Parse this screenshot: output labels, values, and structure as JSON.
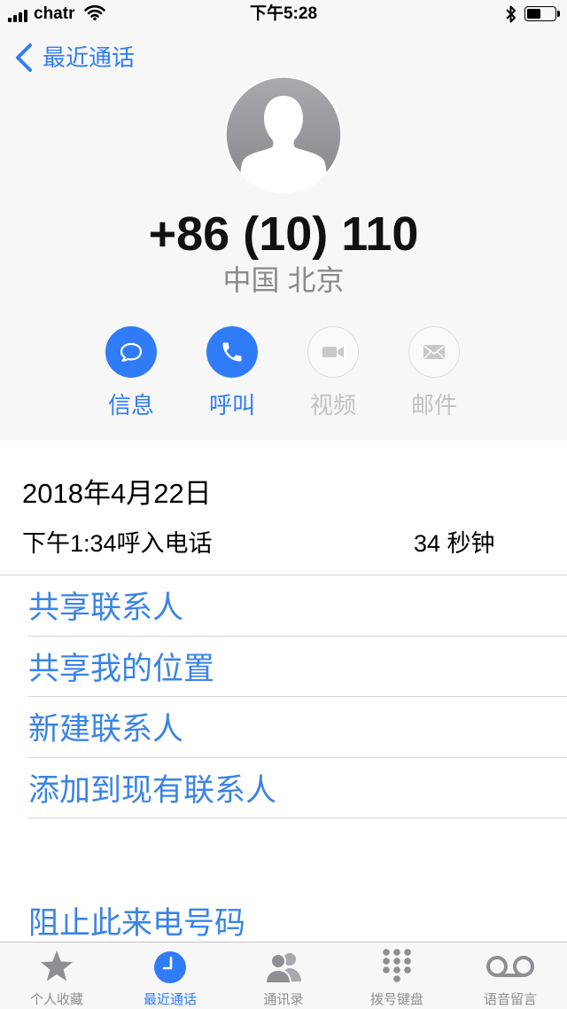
{
  "status_bar": {
    "carrier": "chatr",
    "time": "下午5:28",
    "battery_level": 0.5
  },
  "nav": {
    "back_label": "最近通话"
  },
  "contact": {
    "number": "+86 (10) 110",
    "location": "中国 北京",
    "avatar_icon": "person-silhouette-icon"
  },
  "actions": [
    {
      "label": "信息",
      "icon": "message-icon",
      "enabled": true
    },
    {
      "label": "呼叫",
      "icon": "phone-icon",
      "enabled": true
    },
    {
      "label": "视频",
      "icon": "video-icon",
      "enabled": false
    },
    {
      "label": "邮件",
      "icon": "mail-icon",
      "enabled": false
    }
  ],
  "call_log": {
    "date": "2018年4月22日",
    "time": "下午1:34",
    "type": "呼入电话",
    "duration": "34 秒钟"
  },
  "options": [
    {
      "label": "共享联系人"
    },
    {
      "label": "共享我的位置"
    },
    {
      "label": "新建联系人"
    },
    {
      "label": "添加到现有联系人"
    }
  ],
  "block_option": {
    "label": "阻止此来电号码"
  },
  "tabs": [
    {
      "label": "个人收藏",
      "icon": "star-icon",
      "active": false
    },
    {
      "label": "最近通话",
      "icon": "clock-icon",
      "active": true
    },
    {
      "label": "通讯录",
      "icon": "contacts-icon",
      "active": false
    },
    {
      "label": "拨号键盘",
      "icon": "keypad-icon",
      "active": false
    },
    {
      "label": "语音留言",
      "icon": "voicemail-icon",
      "active": false
    }
  ],
  "colors": {
    "accent": "#2f7cf6",
    "list_text": "#3a84e6",
    "inactive": "#8e8e93",
    "disabled_icon": "#c7c7cc",
    "disabled_label": "#c2c2c6",
    "header_bg": "#f7f7f7",
    "separator": "#d6d6da",
    "secondary_text": "#8a8a8e"
  }
}
